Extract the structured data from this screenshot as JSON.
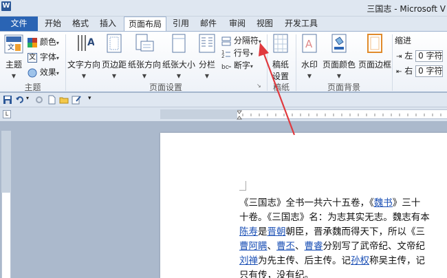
{
  "window": {
    "title": "三国志 - Microsoft V",
    "app_logo": "W"
  },
  "tabs": {
    "file": "文件",
    "items": [
      "开始",
      "格式",
      "插入",
      "页面布局",
      "引用",
      "邮件",
      "审阅",
      "视图",
      "开发工具"
    ],
    "active": "页面布局"
  },
  "ribbon": {
    "theme": {
      "theme_label": "主题",
      "colors_label": "颜色",
      "fonts_label": "字体",
      "effects_label": "效果",
      "group_label": "主题"
    },
    "page_setup": {
      "text_direction": "文字方向",
      "margins": "页边距",
      "orientation": "纸张方向",
      "size": "纸张大小",
      "columns": "分栏",
      "breaks": "分隔符",
      "line_numbers": "行号",
      "hyphenation": "断字",
      "group_label": "页面设置"
    },
    "manuscript": {
      "button_line1": "稿纸",
      "button_line2": "设置",
      "group_label": "稿纸"
    },
    "page_background": {
      "watermark": "水印",
      "page_color": "页面颜色",
      "page_borders": "页面边框",
      "group_label": "页面背景"
    },
    "indent": {
      "title": "缩进",
      "left_label": "左",
      "left_value": "0 字符",
      "right_label": "右",
      "right_value": "0 字符"
    }
  },
  "document": {
    "lines": [
      [
        {
          "t": "《三国志》全书一共六十五卷，《"
        },
        {
          "t": "魏书",
          "link": true
        },
        {
          "t": "》三十"
        }
      ],
      [
        {
          "t": "十卷。《三国志》名：为志其实无志。魏志有本"
        }
      ],
      [
        {
          "t": "陈寿",
          "link": true
        },
        {
          "t": "是"
        },
        {
          "t": "晋朝",
          "link": true
        },
        {
          "t": "朝臣，晋承魏而得天下，所以《三"
        }
      ],
      [
        {
          "t": "曹阿瞒",
          "link": true
        },
        {
          "t": "、"
        },
        {
          "t": "曹丕",
          "link": true
        },
        {
          "t": "、"
        },
        {
          "t": "曹睿",
          "link": true
        },
        {
          "t": "分别写了武帝纪、文帝纪"
        }
      ],
      [
        {
          "t": "刘禅",
          "link": true
        },
        {
          "t": "为先主传、后主传。记"
        },
        {
          "t": "孙权",
          "link": true
        },
        {
          "t": "称吴主传，记"
        }
      ],
      [
        {
          "t": "只有传，没有纪。"
        }
      ]
    ]
  },
  "colors": {
    "file_tab": "#2a64b4",
    "link": "#1a4fb5",
    "arrow": "#e0393e"
  }
}
